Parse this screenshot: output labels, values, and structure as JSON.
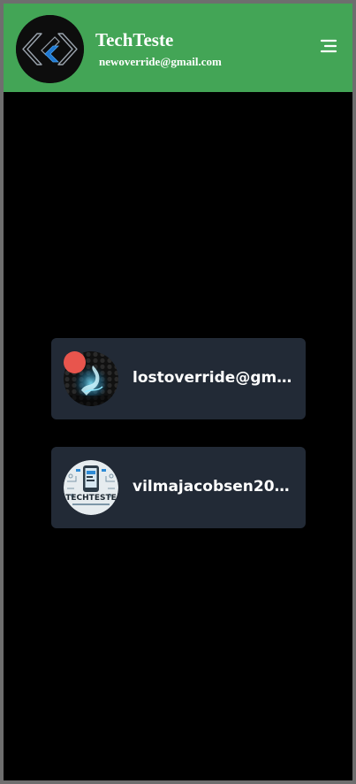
{
  "header": {
    "title": "TechTeste",
    "email": "newoverride@gmail.com",
    "avatar_icon": "flutter-logo-icon",
    "menu_icon": "hamburger-menu-icon"
  },
  "accounts": [
    {
      "label": "lostoverride@gmai...",
      "avatar_icon": "dragon-avatar-icon",
      "has_badge": true,
      "badge_color": "#e8554d"
    },
    {
      "label": "vilmajacobsen2013...",
      "avatar_icon": "techteste-logo-avatar-icon",
      "avatar_text": "TECHTESTE",
      "has_badge": false
    }
  ],
  "colors": {
    "header_bg": "#43a556",
    "page_bg": "#000000",
    "card_bg": "#222a36",
    "text": "#ffffff",
    "badge": "#e8554d"
  }
}
